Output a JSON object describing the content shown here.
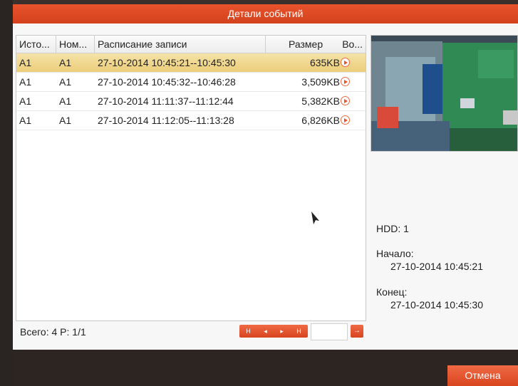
{
  "window": {
    "title": "Детали событий"
  },
  "table": {
    "headers": [
      "Исто...",
      "Ном...",
      "Расписание записи",
      "Размер",
      "Во..."
    ],
    "rows": [
      {
        "source": "A1",
        "num": "A1",
        "schedule": "27-10-2014 10:45:21--10:45:30",
        "size": "635KB",
        "selected": true
      },
      {
        "source": "A1",
        "num": "A1",
        "schedule": "27-10-2014 10:45:32--10:46:28",
        "size": "3,509KB",
        "selected": false
      },
      {
        "source": "A1",
        "num": "A1",
        "schedule": "27-10-2014 11:11:37--11:12:44",
        "size": "5,382KB",
        "selected": false
      },
      {
        "source": "A1",
        "num": "A1",
        "schedule": "27-10-2014 11:12:05--11:13:28",
        "size": "6,826KB",
        "selected": false
      }
    ]
  },
  "footer": {
    "total": "Всего: 4",
    "page": "P: 1/1"
  },
  "pager": {
    "first": "H",
    "prev": "◂",
    "next": "▸",
    "last": "H",
    "go": "→",
    "page_value": ""
  },
  "details": {
    "hdd": "HDD: 1",
    "start_label": "Начало:",
    "start_value": "27-10-2014 10:45:21",
    "end_label": "Конец:",
    "end_value": "27-10-2014 10:45:30"
  },
  "buttons": {
    "cancel": "Отмена"
  },
  "colors": {
    "accent": "#e8532c",
    "selected_row": "#f0d68a"
  }
}
